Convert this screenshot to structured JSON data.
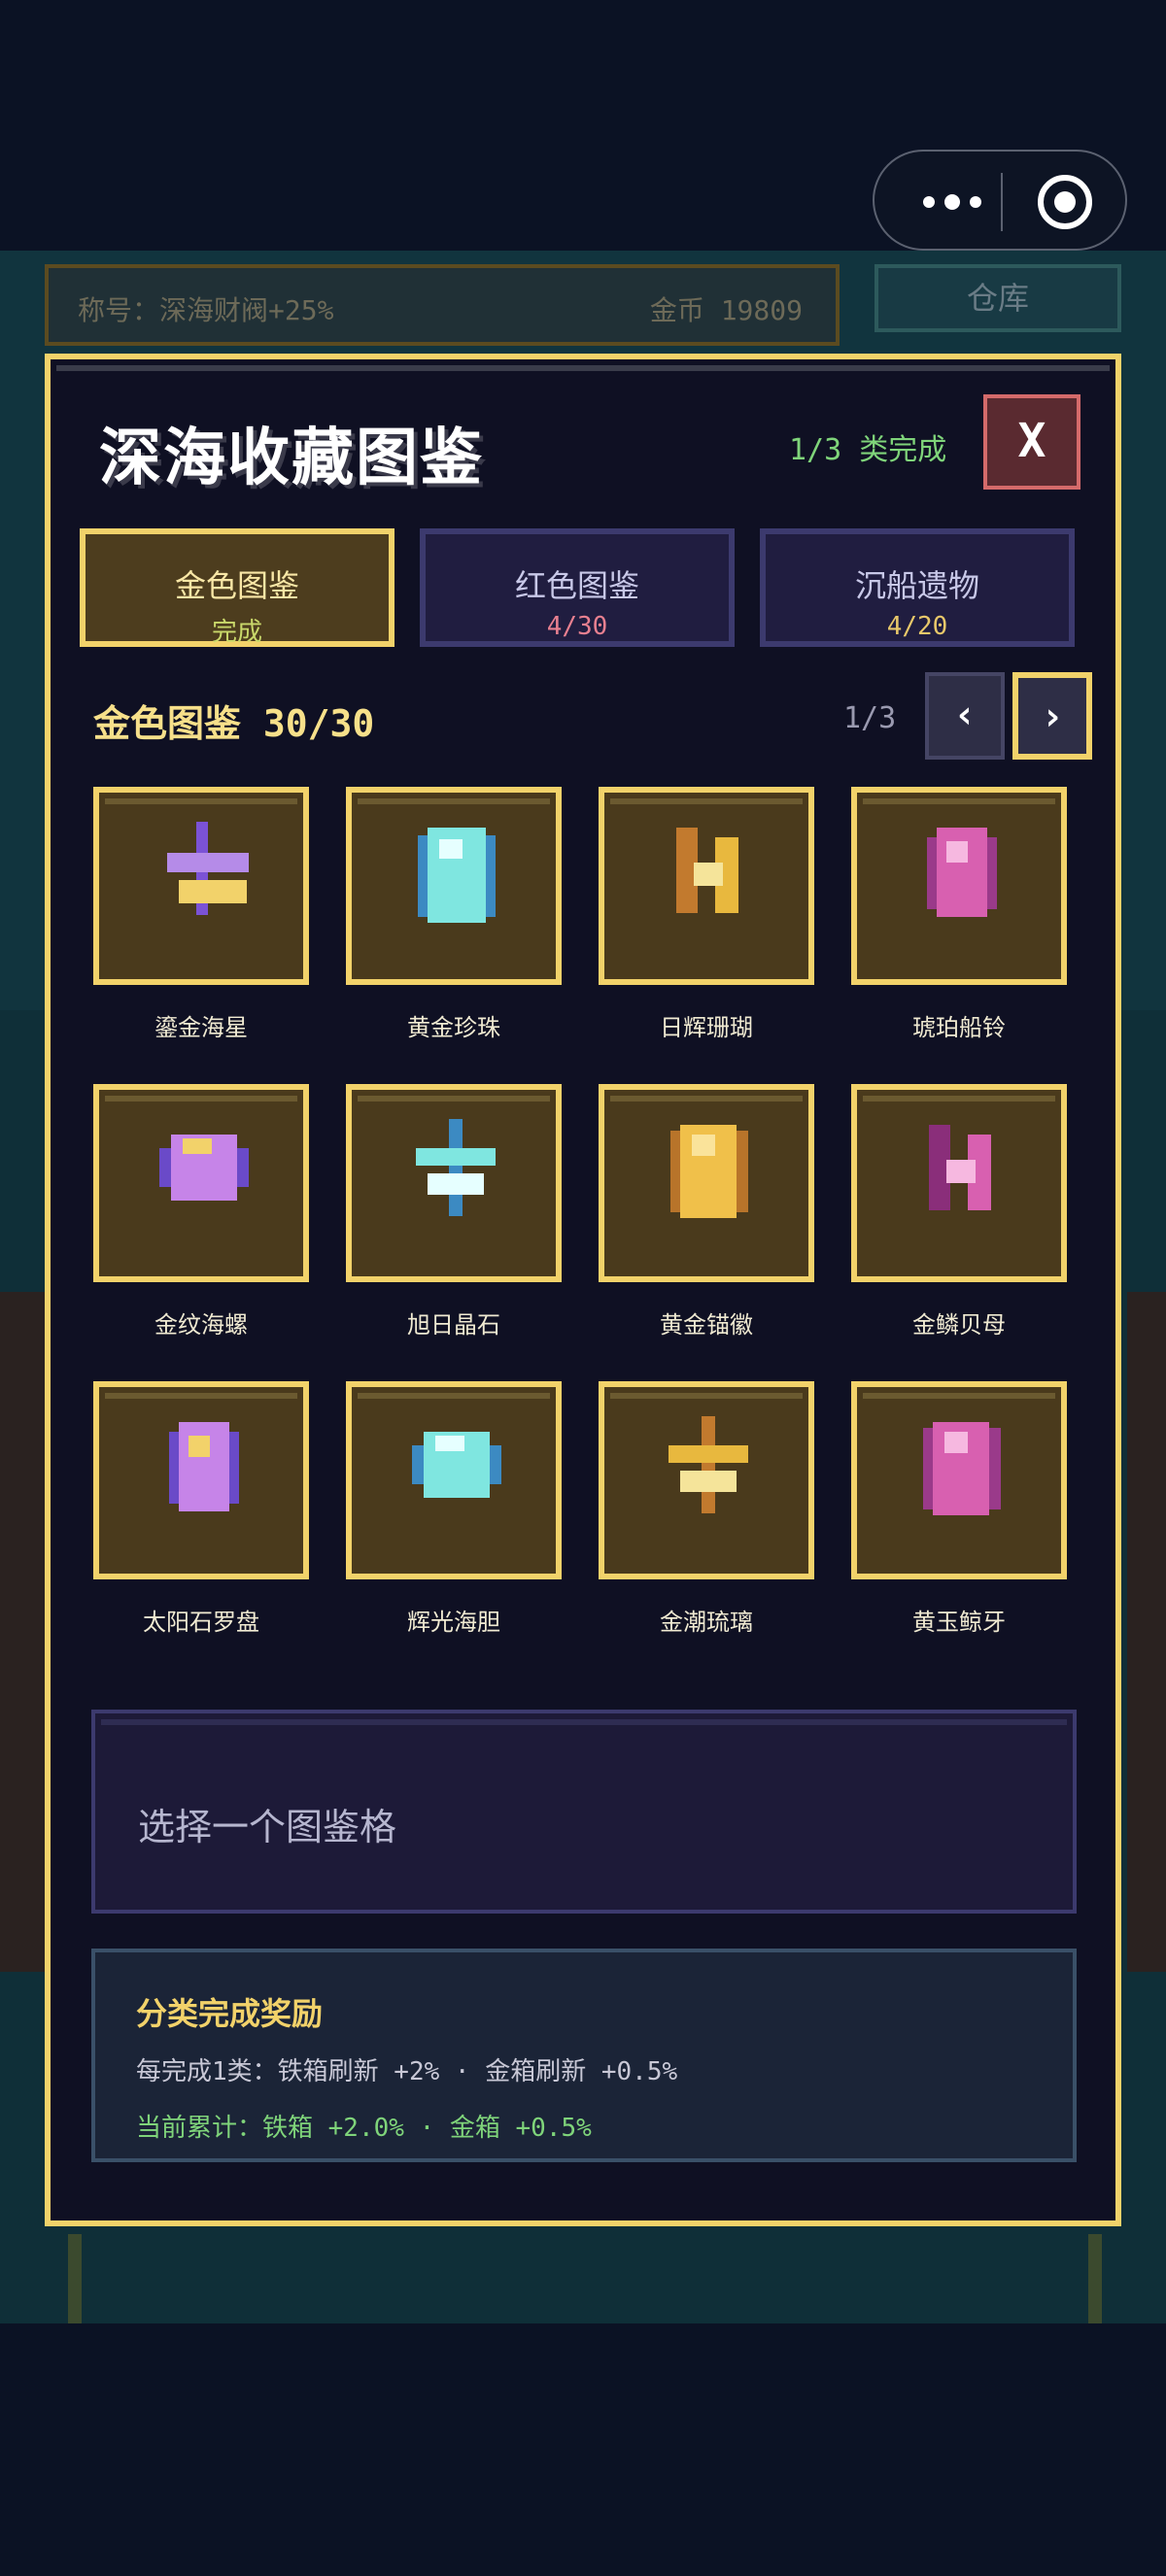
{
  "hud": {
    "title_text": "称号：深海财阀+25%",
    "coin_text": "金币 19809",
    "warehouse_label": "仓库"
  },
  "panel": {
    "title": "深海收藏图鉴",
    "progress_summary": "1/3 类完成",
    "close_label": "X"
  },
  "tabs": [
    {
      "label": "金色图鉴",
      "progress": "完成"
    },
    {
      "label": "红色图鉴",
      "progress": "4/30"
    },
    {
      "label": "沉船遗物",
      "progress": "4/20"
    }
  ],
  "section": {
    "title": "金色图鉴 30/30",
    "page": "1/3",
    "prev_label": "‹",
    "next_label": "›"
  },
  "items": [
    {
      "name": "鎏金海星",
      "icon": "starfish-icon"
    },
    {
      "name": "黄金珍珠",
      "icon": "pearl-icon"
    },
    {
      "name": "日辉珊瑚",
      "icon": "coral-icon"
    },
    {
      "name": "琥珀船铃",
      "icon": "ship-bell-icon"
    },
    {
      "name": "金纹海螺",
      "icon": "conch-icon"
    },
    {
      "name": "旭日晶石",
      "icon": "crystal-icon"
    },
    {
      "name": "黄金锚徽",
      "icon": "anchor-badge-icon"
    },
    {
      "name": "金鳞贝母",
      "icon": "mother-of-pearl-icon"
    },
    {
      "name": "太阳石罗盘",
      "icon": "compass-icon"
    },
    {
      "name": "辉光海胆",
      "icon": "sea-urchin-icon"
    },
    {
      "name": "金潮琉璃",
      "icon": "glass-icon"
    },
    {
      "name": "黄玉鲸牙",
      "icon": "whale-tooth-icon"
    }
  ],
  "info_box": {
    "prompt": "选择一个图鉴格"
  },
  "reward": {
    "title": "分类完成奖励",
    "rule": "每完成1类：铁箱刷新 +2% · 金箱刷新 +0.5%",
    "total": "当前累计：铁箱 +2.0% · 金箱 +0.5%"
  },
  "colors": {
    "panel_border": "#f2d26a",
    "panel_bg": "#0f1023",
    "card_bg": "#4a3a1c",
    "complete_green": "#7fd47a",
    "close_red": "#d46a6a"
  }
}
